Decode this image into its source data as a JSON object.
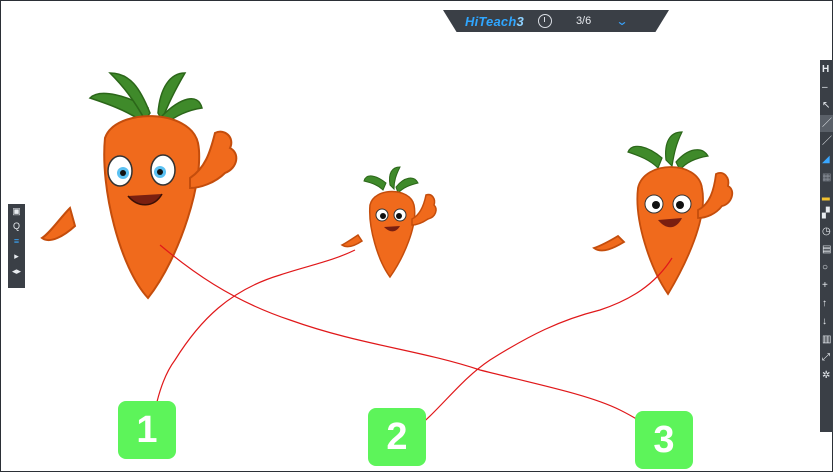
{
  "topbar": {
    "brand_name": "HiTeach",
    "brand_version": "3",
    "timer_icon": "clock-icon",
    "page_indicator": "3/6",
    "menu_icon": "chevron-down-icon"
  },
  "left_toolbar": {
    "icons": [
      "screen-icon",
      "search-icon",
      "menu-icon",
      "play-icon",
      "expand-icon"
    ]
  },
  "right_toolbar": {
    "icons": [
      "hiteach-logo-icon",
      "minus-icon",
      "cursor-icon",
      "pen-icon",
      "marker-icon",
      "eraser-icon",
      "grid-icon",
      "highlight-icon",
      "users-icon",
      "timer-icon",
      "calendar-icon",
      "search-icon",
      "plus-icon",
      "up-arrow-icon",
      "down-arrow-icon",
      "delete-icon",
      "fullscreen-icon",
      "settings-icon"
    ]
  },
  "tiles": [
    {
      "label": "1"
    },
    {
      "label": "2"
    },
    {
      "label": "3"
    }
  ],
  "colors": {
    "tile": "#5df45a",
    "carrot_body": "#f06a1c",
    "leaves": "#3f8a2a",
    "ink_line": "#e0181a",
    "toolbar": "#3a3f46",
    "brand": "#2fa6ff"
  }
}
